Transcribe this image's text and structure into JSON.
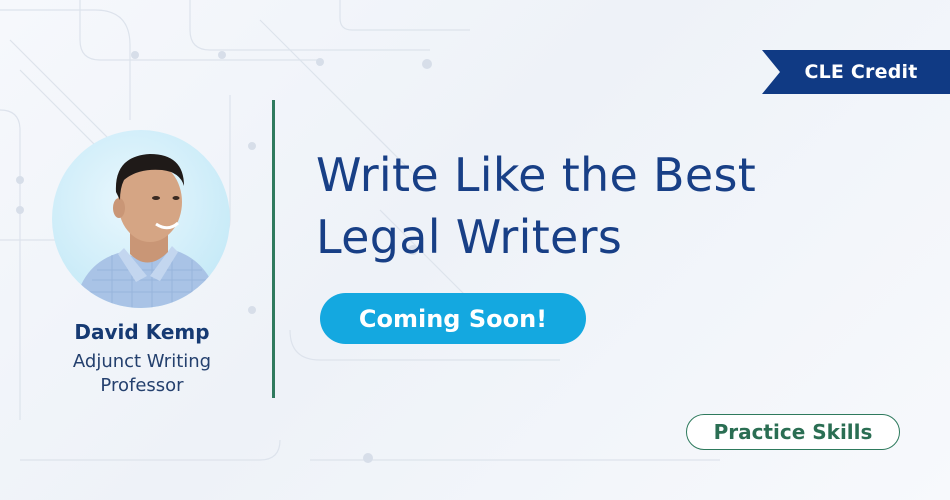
{
  "badge": {
    "label": "CLE Credit"
  },
  "instructor": {
    "name": "David Kemp",
    "role_line1": "Adjunct Writing",
    "role_line2": "Professor"
  },
  "course": {
    "title_line1": "Write Like the Best",
    "title_line2": "Legal Writers"
  },
  "cta": {
    "label": "Coming Soon!"
  },
  "tag": {
    "label": "Practice Skills"
  },
  "colors": {
    "navy": "#103a84",
    "title": "#183f86",
    "cta": "#14a8e0",
    "green": "#2f7a5e"
  }
}
